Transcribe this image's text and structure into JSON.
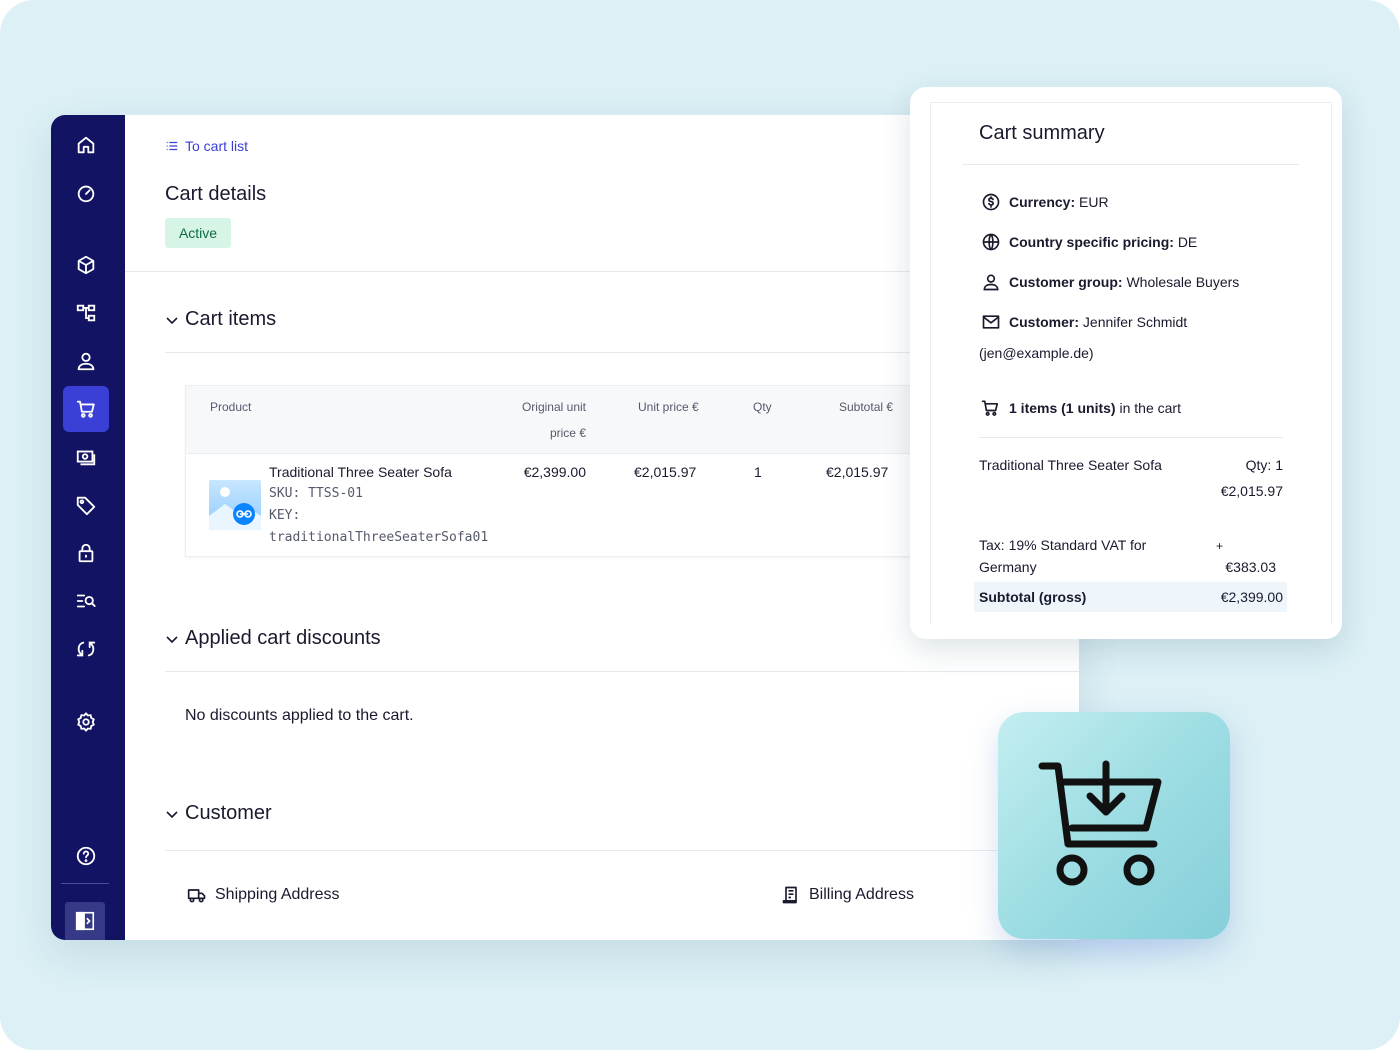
{
  "nav": {
    "items": [
      "home-icon",
      "dashboard-icon",
      "box-icon",
      "hierarchy-icon",
      "user-icon",
      "cart-icon",
      "money-icon",
      "tag-icon",
      "lock-icon",
      "search-list-icon",
      "sync-icon",
      "settings-icon",
      "help-icon"
    ],
    "active": "cart-icon"
  },
  "header": {
    "back_link": "To cart list",
    "title": "Cart details",
    "status": "Active"
  },
  "sections": {
    "cart_items": "Cart items",
    "discounts": "Applied cart discounts",
    "customer": "Customer"
  },
  "table": {
    "columns": {
      "product": "Product",
      "original_unit_price": "Original unit price €",
      "unit_price": "Unit price €",
      "qty": "Qty",
      "subtotal": "Subtotal €"
    },
    "rows": [
      {
        "name": "Traditional Three Seater Sofa",
        "sku": "SKU: TTSS-01",
        "key_label": "KEY:",
        "key": "traditionalThreeSeaterSofa01",
        "original_unit_price": "€2,399.00",
        "unit_price": "€2,015.97",
        "qty": "1",
        "subtotal": "€2,015.97"
      }
    ]
  },
  "discounts": {
    "empty": "No discounts applied to the cart."
  },
  "customer": {
    "shipping": "Shipping Address",
    "billing": "Billing Address"
  },
  "summary": {
    "title": "Cart summary",
    "currency_label": "Currency:",
    "currency": "EUR",
    "country_label": "Country specific pricing:",
    "country": "DE",
    "group_label": "Customer group:",
    "group": "Wholesale Buyers",
    "customer_label": "Customer:",
    "customer": "Jennifer Schmidt",
    "email": "(jen@example.de)",
    "items_bold": "1 items (1 units)",
    "items_suffix": "in the cart",
    "line_item": "Traditional Three Seater Sofa",
    "line_qty": "Qty: 1",
    "line_price": "€2,015.97",
    "tax_label_1": "Tax: 19% Standard VAT for",
    "tax_label_2": "Germany",
    "tax_plus": "+",
    "tax_value": "€383.03",
    "subtotal_label": "Subtotal (gross)",
    "subtotal_value": "€2,399.00"
  },
  "colors": {
    "sidebar": "#121362",
    "accent": "#3a3fd6",
    "active_badge_bg": "#d6f5e6",
    "active_badge_text": "#0e6b43",
    "background": "#dcf0f5"
  }
}
